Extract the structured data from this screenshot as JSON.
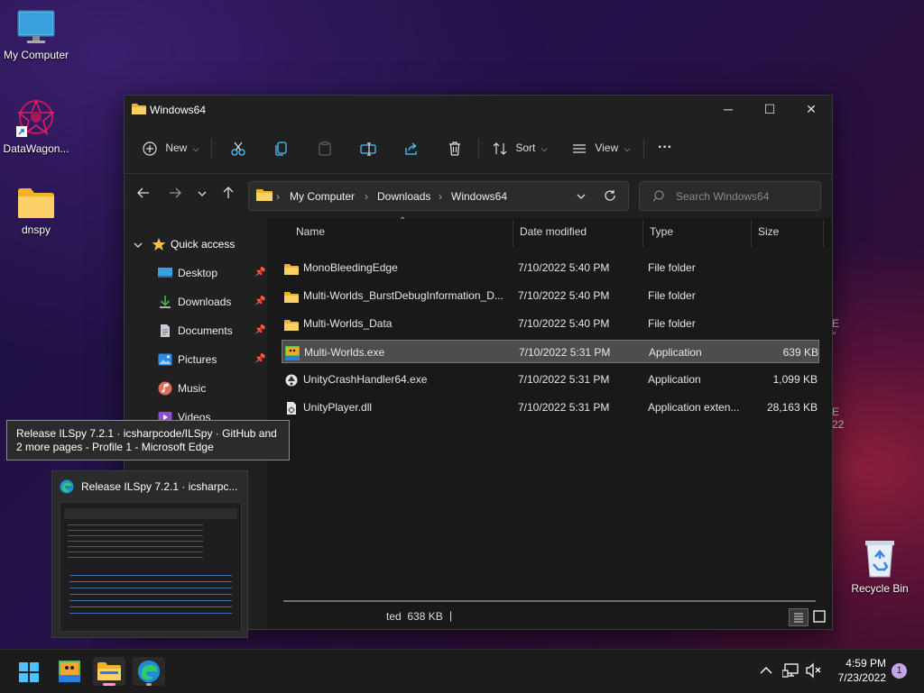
{
  "desktop": {
    "icons": [
      {
        "label": "My Computer",
        "icon": "monitor-icon"
      },
      {
        "label": "DataWagon...",
        "icon": "datawagon-icon"
      },
      {
        "label": "dnspy",
        "icon": "folder-icon"
      },
      {
        "label": "Recycle Bin",
        "icon": "recycle-bin-icon"
      }
    ]
  },
  "window": {
    "title": "Windows64",
    "controls": {
      "minimize": "─",
      "maximize": "☐",
      "close": "✕"
    },
    "toolbar": {
      "new_label": "New",
      "sort_label": "Sort",
      "view_label": "View",
      "more_label": "···"
    },
    "address": {
      "crumbs": [
        "My Computer",
        "Downloads",
        "Windows64"
      ],
      "search_placeholder": "Search Windows64"
    },
    "sidebar": {
      "quick_access": "Quick access",
      "items": [
        {
          "label": "Desktop",
          "pinned": true
        },
        {
          "label": "Downloads",
          "pinned": true
        },
        {
          "label": "Documents",
          "pinned": true
        },
        {
          "label": "Pictures",
          "pinned": true
        },
        {
          "label": "Music",
          "pinned": false
        },
        {
          "label": "Videos",
          "pinned": false
        }
      ]
    },
    "columns": {
      "name": "Name",
      "date": "Date modified",
      "type": "Type",
      "size": "Size"
    },
    "files": [
      {
        "name": "MonoBleedingEdge",
        "date": "7/10/2022 5:40 PM",
        "type": "File folder",
        "size": "",
        "icon": "folder-icon",
        "selected": false
      },
      {
        "name": "Multi-Worlds_BurstDebugInformation_D...",
        "date": "7/10/2022 5:40 PM",
        "type": "File folder",
        "size": "",
        "icon": "folder-icon",
        "selected": false
      },
      {
        "name": "Multi-Worlds_Data",
        "date": "7/10/2022 5:40 PM",
        "type": "File folder",
        "size": "",
        "icon": "folder-icon",
        "selected": false
      },
      {
        "name": "Multi-Worlds.exe",
        "date": "7/10/2022 5:31 PM",
        "type": "Application",
        "size": "639 KB",
        "icon": "app-icon",
        "selected": true
      },
      {
        "name": "UnityCrashHandler64.exe",
        "date": "7/10/2022 5:31 PM",
        "type": "Application",
        "size": "1,099 KB",
        "icon": "unity-icon",
        "selected": false
      },
      {
        "name": "UnityPlayer.dll",
        "date": "7/10/2022 5:31 PM",
        "type": "Application exten...",
        "size": "28,163 KB",
        "icon": "dll-icon",
        "selected": false
      }
    ],
    "status": {
      "selected_text": "ted  638 KB",
      "cursor": "|"
    }
  },
  "tooltip": {
    "line1": "Release ILSpy 7.2.1 · icsharpcode/ILSpy · GitHub and",
    "line2": "2 more pages - Profile 1 - Microsoft Edge"
  },
  "thumbnail": {
    "title": "Release ILSpy 7.2.1 · icsharpc..."
  },
  "taskbar": {
    "time": "4:59 PM",
    "date": "7/23/2022",
    "notification_count": "1"
  },
  "colors": {
    "accent": "#4cc2ff",
    "selected_row": "#4d4d4d",
    "window_bg": "#202020"
  }
}
